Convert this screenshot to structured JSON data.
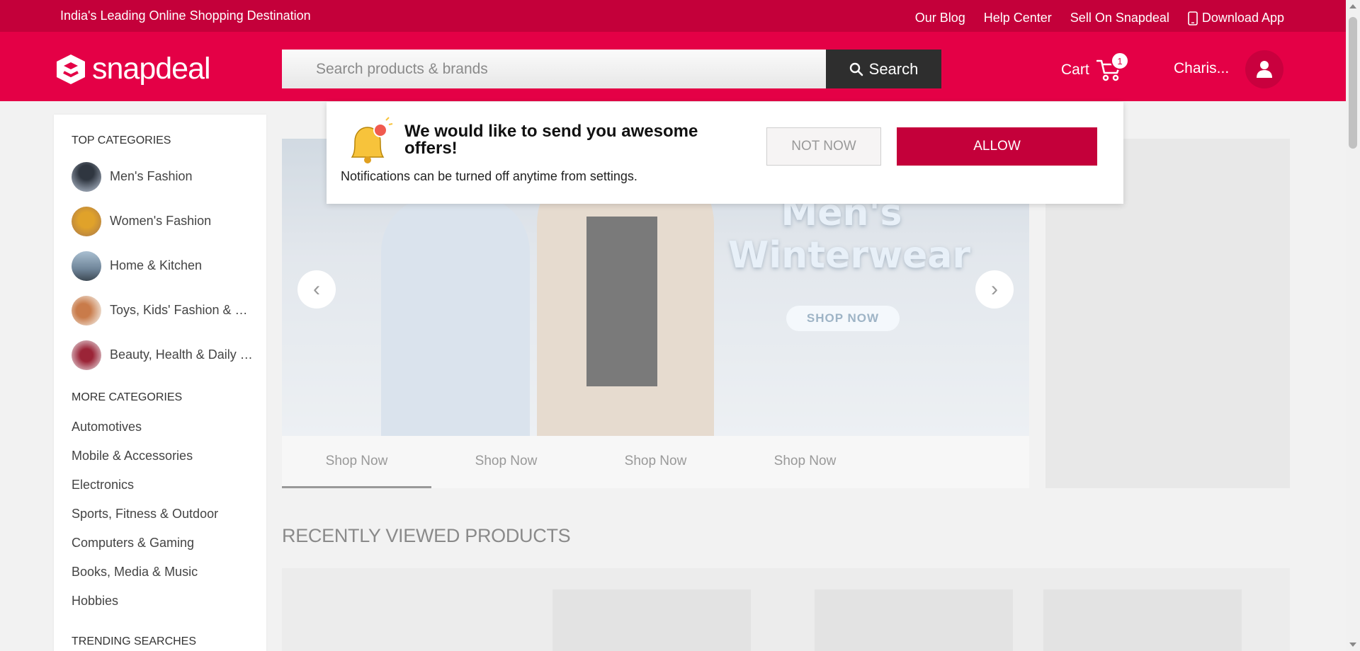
{
  "topbar": {
    "tagline": "India's Leading Online Shopping Destination",
    "links": [
      "Our Blog",
      "Help Center",
      "Sell On Snapdeal",
      "Download App"
    ]
  },
  "header": {
    "logo_text": "snapdeal",
    "search_placeholder": "Search products & brands",
    "search_button": "Search",
    "cart_label": "Cart",
    "cart_count": "1",
    "user_name": "Charis..."
  },
  "sidebar": {
    "top_title": "TOP CATEGORIES",
    "top_items": [
      {
        "label": "Men's Fashion"
      },
      {
        "label": "Women's Fashion"
      },
      {
        "label": "Home & Kitchen"
      },
      {
        "label": "Toys, Kids' Fashion & more"
      },
      {
        "label": "Beauty, Health & Daily Needs"
      }
    ],
    "more_title": "MORE CATEGORIES",
    "more_items": [
      "Automotives",
      "Mobile & Accessories",
      "Electronics",
      "Sports, Fitness & Outdoor",
      "Computers & Gaming",
      "Books, Media & Music",
      "Hobbies"
    ],
    "trending_title": "TRENDING SEARCHES"
  },
  "banner": {
    "headline_line1": "Men's",
    "headline_line2": "Winterwear",
    "cta": "SHOP NOW",
    "tabs": [
      "Shop Now",
      "Shop Now",
      "Shop Now",
      "Shop Now"
    ]
  },
  "recent": {
    "title": "RECENTLY VIEWED PRODUCTS"
  },
  "notification": {
    "title": "We would like to send you awesome offers!",
    "subtitle": "Notifications can be turned off anytime from settings.",
    "not_now": "NOT NOW",
    "allow": "ALLOW"
  },
  "colors": {
    "brand": "#e40046",
    "topbar": "#c4003a",
    "search_button": "#2e2e2e"
  }
}
